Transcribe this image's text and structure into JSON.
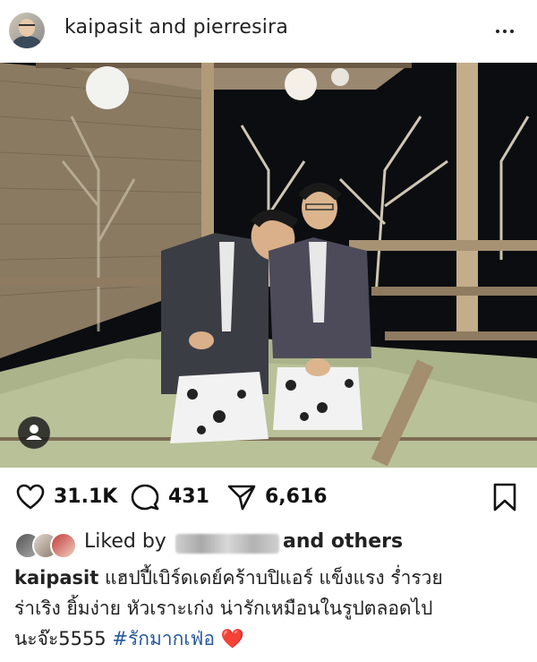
{
  "post": {
    "author_line": "kaipasit and pierresira",
    "more_label": "•••"
  },
  "actions": {
    "likes": "31.1K",
    "comments": "431",
    "shares": "6,616"
  },
  "liked_by": {
    "prefix": "Liked by",
    "suffix": "and others"
  },
  "caption": {
    "username": "kaipasit",
    "line1": "แฮปปี้เบิร์ดเดย์คร้าบปิแอร์ แข็งแรง ร่ำรวย",
    "line2": "ร่าเริง ยิ้มง่าย หัวเราะเก่ง น่ารักเหมือนในรูปตลอดไป",
    "line3_text": "นะจ๊ะ5555",
    "hashtag": "#รักมากเฟ่อ",
    "emoji": "❤️"
  },
  "colors": {
    "hashtag": "#26589f",
    "heart": "#e0272c"
  },
  "icons": [
    "avatar",
    "more-icon",
    "tag-people-icon",
    "heart-icon",
    "comment-icon",
    "share-icon",
    "bookmark-icon"
  ]
}
